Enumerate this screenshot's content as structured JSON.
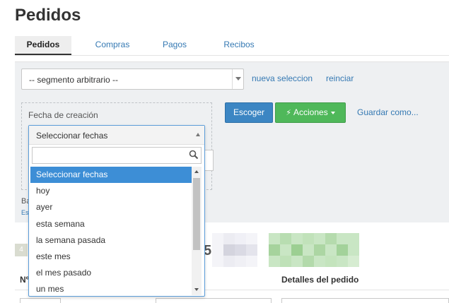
{
  "page_title": "Pedidos",
  "tabs": [
    {
      "label": "Pedidos",
      "active": true
    },
    {
      "label": "Compras",
      "active": false
    },
    {
      "label": "Pagos",
      "active": false
    },
    {
      "label": "Recibos",
      "active": false
    }
  ],
  "segment": {
    "selected": "-- segmento arbitrario --",
    "new_selection_link": "nueva seleccion",
    "reset_link": "reinciar"
  },
  "filter": {
    "label": "Fecha de creación",
    "left_text_1": "Ba",
    "left_text_2": "Es"
  },
  "buttons": {
    "choose": "Escoger",
    "actions": "Acciones",
    "save_as": "Guardar como..."
  },
  "date_dropdown": {
    "selected": "Seleccionar fechas",
    "search_value": "",
    "options": [
      "Seleccionar fechas",
      "hoy",
      "ayer",
      "esta semana",
      "la semana pasada",
      "este mes",
      "el mes pasado",
      "un mes"
    ],
    "highlighted_index": 0
  },
  "summary": {
    "badge": "4",
    "count_digit": "5"
  },
  "table": {
    "headers": {
      "number": "Nº",
      "details": "Detalles del pedido"
    }
  },
  "colors": {
    "primary": "#3c86c3",
    "success": "#4fb85a",
    "link": "#3579b3",
    "highlight": "#3d8ed6"
  }
}
